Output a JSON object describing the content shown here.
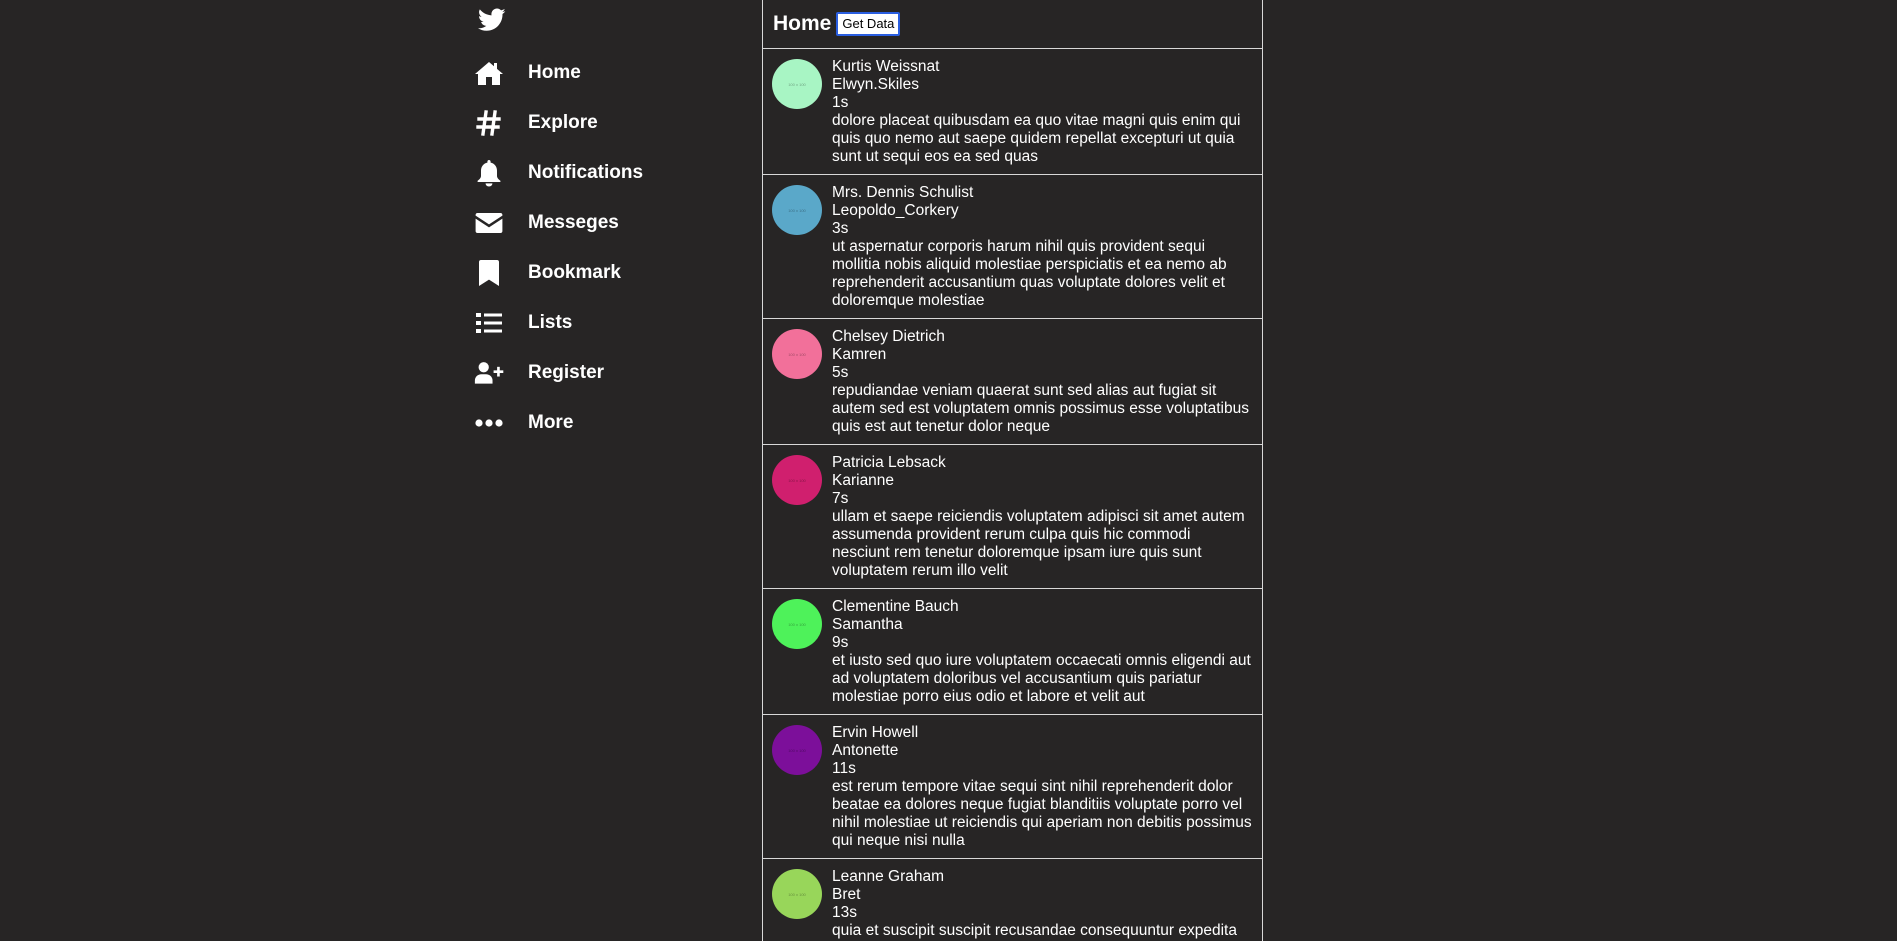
{
  "sidebar": {
    "logo_icon": "twitter-bird-icon",
    "items": [
      {
        "label": "Home",
        "icon": "home-icon"
      },
      {
        "label": "Explore",
        "icon": "hashtag-icon"
      },
      {
        "label": "Notifications",
        "icon": "bell-icon"
      },
      {
        "label": "Messeges",
        "icon": "envelope-icon"
      },
      {
        "label": "Bookmark",
        "icon": "bookmark-icon"
      },
      {
        "label": "Lists",
        "icon": "list-icon"
      },
      {
        "label": "Register",
        "icon": "user-plus-icon"
      },
      {
        "label": "More",
        "icon": "more-dots-icon"
      }
    ]
  },
  "header": {
    "title": "Home",
    "get_data_label": "Get Data"
  },
  "avatar_placeholder": "100 x 100",
  "tweets": [
    {
      "name": "Kurtis Weissnat",
      "username": "Elwyn.Skiles",
      "time": "1s",
      "color": "#a8f5c4",
      "body": "dolore placeat quibusdam ea quo vitae magni quis enim qui quis quo nemo aut saepe quidem repellat excepturi ut quia sunt ut sequi eos ea sed quas"
    },
    {
      "name": "Mrs. Dennis Schulist",
      "username": "Leopoldo_Corkery",
      "time": "3s",
      "color": "#5aa8c9",
      "body": "ut aspernatur corporis harum nihil quis provident sequi mollitia nobis aliquid molestiae perspiciatis et ea nemo ab reprehenderit accusantium quas voluptate dolores velit et doloremque molestiae"
    },
    {
      "name": "Chelsey Dietrich",
      "username": "Kamren",
      "time": "5s",
      "color": "#f2709a",
      "body": "repudiandae veniam quaerat sunt sed alias aut fugiat sit autem sed est voluptatem omnis possimus esse voluptatibus quis est aut tenetur dolor neque"
    },
    {
      "name": "Patricia Lebsack",
      "username": "Karianne",
      "time": "7s",
      "color": "#d01f6e",
      "body": "ullam et saepe reiciendis voluptatem adipisci sit amet autem assumenda provident rerum culpa quis hic commodi nesciunt rem tenetur doloremque ipsam iure quis sunt voluptatem rerum illo velit"
    },
    {
      "name": "Clementine Bauch",
      "username": "Samantha",
      "time": "9s",
      "color": "#4ef25a",
      "body": "et iusto sed quo iure voluptatem occaecati omnis eligendi aut ad voluptatem doloribus vel accusantium quis pariatur molestiae porro eius odio et labore et velit aut"
    },
    {
      "name": "Ervin Howell",
      "username": "Antonette",
      "time": "11s",
      "color": "#7c0f9a",
      "body": "est rerum tempore vitae sequi sint nihil reprehenderit dolor beatae ea dolores neque fugiat blanditiis voluptate porro vel nihil molestiae ut reiciendis qui aperiam non debitis possimus qui neque nisi nulla"
    },
    {
      "name": "Leanne Graham",
      "username": "Bret",
      "time": "13s",
      "color": "#98d65a",
      "body": "quia et suscipit suscipit recusandae consequuntur expedita et cum reprehenderit molestiae ut ut quas totam nostrum rerum est autem sunt rem eveniet architecto"
    }
  ]
}
